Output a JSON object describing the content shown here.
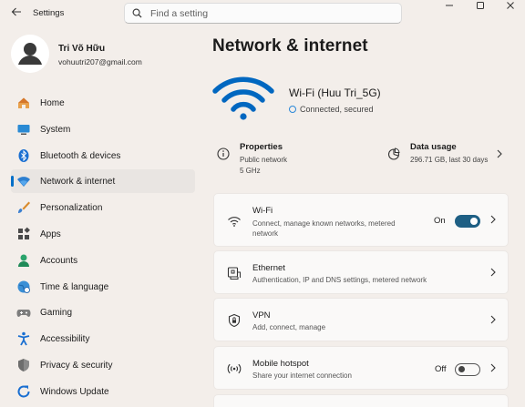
{
  "app": {
    "title": "Settings"
  },
  "search": {
    "placeholder": "Find a setting"
  },
  "user": {
    "name": "Tri Võ Hữu",
    "email": "vohuutri207@gmail.com"
  },
  "nav": [
    {
      "label": "Home",
      "icon": "home-icon"
    },
    {
      "label": "System",
      "icon": "system-icon"
    },
    {
      "label": "Bluetooth & devices",
      "icon": "bluetooth-icon"
    },
    {
      "label": "Network & internet",
      "icon": "network-icon",
      "active": true
    },
    {
      "label": "Personalization",
      "icon": "brush-icon"
    },
    {
      "label": "Apps",
      "icon": "apps-icon"
    },
    {
      "label": "Accounts",
      "icon": "accounts-icon"
    },
    {
      "label": "Time & language",
      "icon": "globe-icon"
    },
    {
      "label": "Gaming",
      "icon": "gamepad-icon"
    },
    {
      "label": "Accessibility",
      "icon": "accessibility-icon"
    },
    {
      "label": "Privacy & security",
      "icon": "shield-icon"
    },
    {
      "label": "Windows Update",
      "icon": "update-icon"
    }
  ],
  "main": {
    "title": "Network & internet",
    "connection": {
      "name": "Wi-Fi (Huu Tri_5G)",
      "status": "Connected, secured"
    },
    "properties": {
      "title": "Properties",
      "lines": [
        "Public network",
        "5 GHz"
      ]
    },
    "data_usage": {
      "title": "Data usage",
      "detail": "296.71 GB, last 30 days"
    },
    "cards": {
      "wifi": {
        "title": "Wi-Fi",
        "desc": "Connect, manage known networks, metered network",
        "toggle_label": "On",
        "toggle_on": true
      },
      "ethernet": {
        "title": "Ethernet",
        "desc": "Authentication, IP and DNS settings, metered network"
      },
      "vpn": {
        "title": "VPN",
        "desc": "Add, connect, manage"
      },
      "hotspot": {
        "title": "Mobile hotspot",
        "desc": "Share your internet connection",
        "toggle_label": "Off",
        "toggle_on": false
      }
    }
  },
  "colors": {
    "accent": "#006fc8",
    "toggle_on": "#1e5f84",
    "wifi_hero": "#0067c0",
    "background": "#f3eeea"
  }
}
